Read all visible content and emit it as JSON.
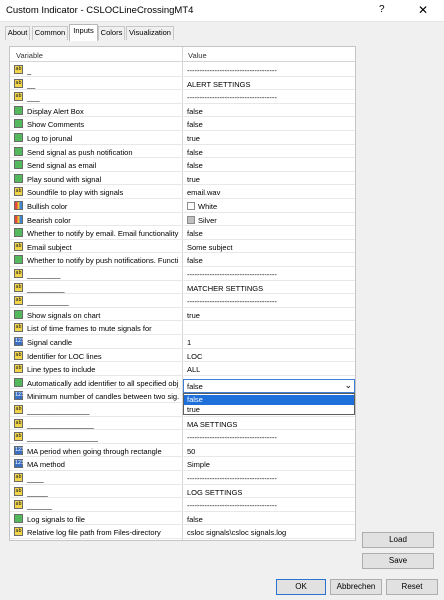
{
  "window": {
    "title": "Custom Indicator - CSLOCLineCrossingMT4",
    "help": "?",
    "close": "✕"
  },
  "tabs": [
    "About",
    "Common",
    "Inputs",
    "Colors",
    "Visualization"
  ],
  "grid": {
    "header_variable": "Variable",
    "header_value": "Value"
  },
  "rows": [
    {
      "type": "ab",
      "var": "_",
      "val": "------------------------------------"
    },
    {
      "type": "ab",
      "var": "__",
      "val": "ALERT SETTINGS"
    },
    {
      "type": "ab",
      "var": "___",
      "val": "------------------------------------"
    },
    {
      "type": "bool",
      "var": "Display Alert Box",
      "val": "false"
    },
    {
      "type": "bool",
      "var": "Show Comments",
      "val": "false"
    },
    {
      "type": "bool",
      "var": "Log to jorunal",
      "val": "true"
    },
    {
      "type": "bool",
      "var": "Send signal as push notification",
      "val": "false"
    },
    {
      "type": "bool",
      "var": "Send signal as email",
      "val": "false"
    },
    {
      "type": "bool",
      "var": "Play sound with signal",
      "val": "true"
    },
    {
      "type": "ab",
      "var": "Soundfile to play with signals",
      "val": "email.wav"
    },
    {
      "type": "color",
      "var": "Bullish color",
      "val": "White",
      "swatch": "#ffffff"
    },
    {
      "type": "color",
      "var": "Bearish color",
      "val": "Silver",
      "swatch": "#c0c0c0"
    },
    {
      "type": "bool",
      "var": "Whether to notify by email. Email functionality ...",
      "val": "false"
    },
    {
      "type": "ab",
      "var": "Email subject",
      "val": "Some subject"
    },
    {
      "type": "bool",
      "var": "Whether to notify by push notifications. Functi...",
      "val": "false"
    },
    {
      "type": "ab",
      "var": "________",
      "val": "------------------------------------"
    },
    {
      "type": "ab",
      "var": "_________",
      "val": "MATCHER SETTINGS"
    },
    {
      "type": "ab",
      "var": "__________",
      "val": "------------------------------------"
    },
    {
      "type": "bool",
      "var": "Show signals on chart",
      "val": "true"
    },
    {
      "type": "ab",
      "var": "List of time frames to mute signals for",
      "val": ""
    },
    {
      "type": "int",
      "var": "Signal candle",
      "val": "1"
    },
    {
      "type": "ab",
      "var": "Identifier for LOC lines",
      "val": "LOC"
    },
    {
      "type": "ab",
      "var": "Line types to include",
      "val": "ALL"
    },
    {
      "type": "bool",
      "var": "Automatically add identifier to all specified obj...",
      "val": ""
    },
    {
      "type": "int",
      "var": "Minimum number of candles between two sig...",
      "val": ""
    },
    {
      "type": "ab",
      "var": "_______________",
      "val": ""
    },
    {
      "type": "ab",
      "var": "________________",
      "val": "MA SETTINGS"
    },
    {
      "type": "ab",
      "var": "_________________",
      "val": "------------------------------------"
    },
    {
      "type": "int",
      "var": "MA period when going through rectangle",
      "val": "50"
    },
    {
      "type": "int",
      "var": "MA method",
      "val": "Simple"
    },
    {
      "type": "ab",
      "var": "____",
      "val": "------------------------------------"
    },
    {
      "type": "ab",
      "var": "_____",
      "val": "LOG SETTINGS"
    },
    {
      "type": "ab",
      "var": "______",
      "val": "------------------------------------"
    },
    {
      "type": "bool",
      "var": "Log signals to file",
      "val": "false"
    },
    {
      "type": "ab",
      "var": "Relative log file path from Files-directory",
      "val": "csloc signals\\csloc signals.log"
    }
  ],
  "dropdown": {
    "value": "false",
    "options": [
      "false",
      "true"
    ],
    "selected": "false"
  },
  "buttons": {
    "load": "Load",
    "save": "Save",
    "ok": "OK",
    "cancel": "Abbrechen",
    "reset": "Reset"
  },
  "icon_text": {
    "ab": "ab",
    "bool": "",
    "int": "123",
    "color": ""
  }
}
